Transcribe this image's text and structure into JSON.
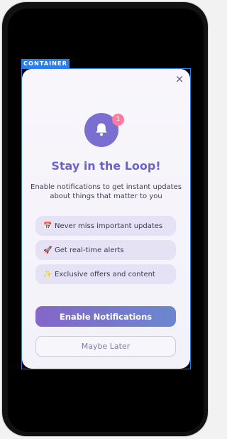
{
  "overlay": {
    "container_label": "CONTAINER"
  },
  "modal": {
    "close_icon": "×",
    "badge_count": "1",
    "title": "Stay in the Loop!",
    "subtitle": "Enable notifications to get instant updates about things that matter to you",
    "features": [
      {
        "icon": "📅",
        "label": "Never miss important updates"
      },
      {
        "icon": "🚀",
        "label": "Get real-time alerts"
      },
      {
        "icon": "✨",
        "label": "Exclusive offers and content"
      }
    ],
    "enable_label": "Enable Notifications",
    "later_label": "Maybe Later"
  },
  "colors": {
    "accent": "#6d63cd",
    "bell_bg": "#7a6fd1",
    "badge": "#ff7aa3",
    "container_outline": "#2b7de9"
  }
}
